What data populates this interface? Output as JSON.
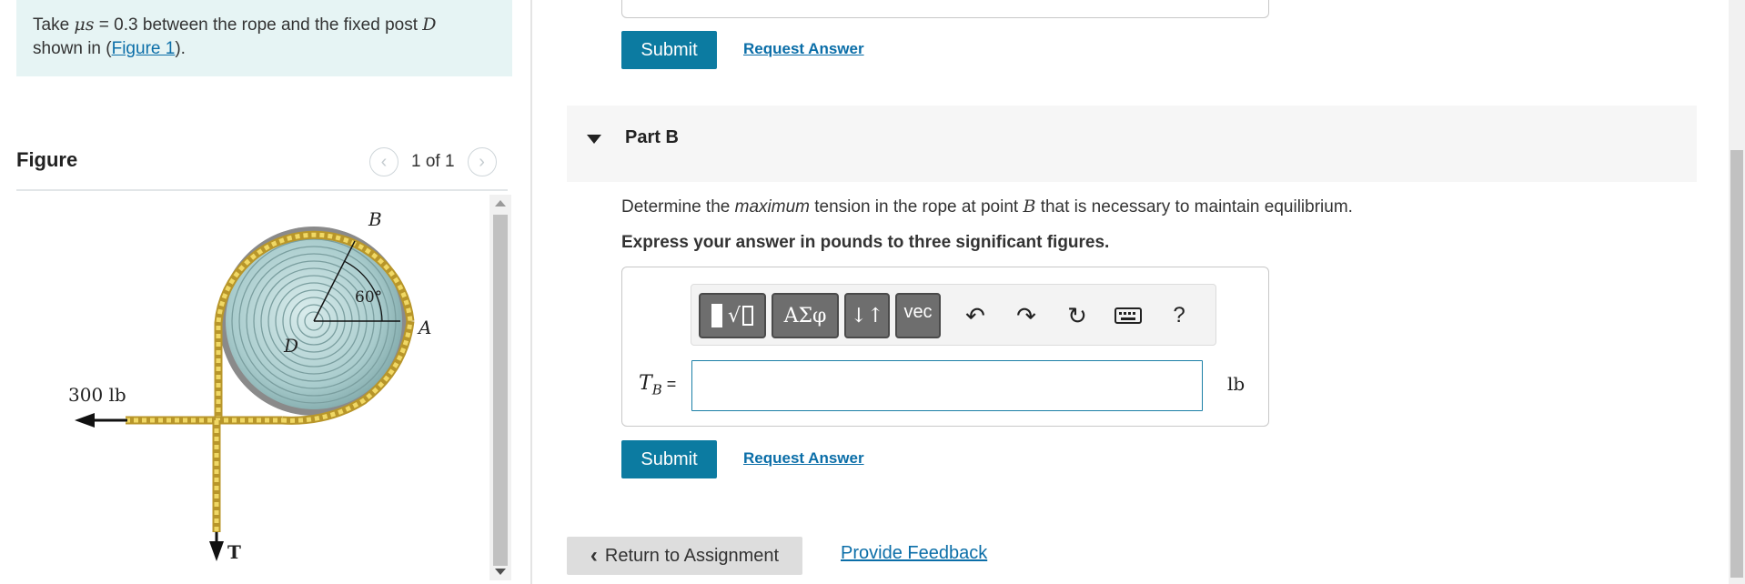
{
  "problem": {
    "text_before": "Take ",
    "mu": "μs",
    "text_value": " = 0.3 between the rope and the fixed post ",
    "post": "D",
    "text_shown": "shown in (",
    "figure_link": "Figure 1",
    "text_end": ")."
  },
  "figure_panel": {
    "title": "Figure",
    "prev_icon": "chevron-left-icon",
    "next_icon": "chevron-right-icon",
    "count": "1 of 1",
    "labels": {
      "B": "B",
      "A": "A",
      "D": "D",
      "T": "T",
      "angle": "60°",
      "force": "300 lb"
    }
  },
  "part_a": {
    "submit": "Submit",
    "request": "Request Answer"
  },
  "part_b": {
    "title": "Part B",
    "question_pre": "Determine the ",
    "question_em": "maximum",
    "question_mid": " tension in the rope at point ",
    "question_point": "B",
    "question_post": " that is necessary to maintain equilibrium.",
    "instruction": "Express your answer in pounds to three significant figures.",
    "toolbar": {
      "templates": "√",
      "greek": "ΑΣφ",
      "arrows": "↓↑",
      "vec": "vec",
      "help": "?"
    },
    "answer_label": "T",
    "answer_sub": "B",
    "answer_eq": " =",
    "answer_value": "",
    "unit": "lb",
    "submit": "Submit",
    "request": "Request Answer"
  },
  "footer": {
    "return": "Return to Assignment",
    "feedback": "Provide Feedback"
  }
}
